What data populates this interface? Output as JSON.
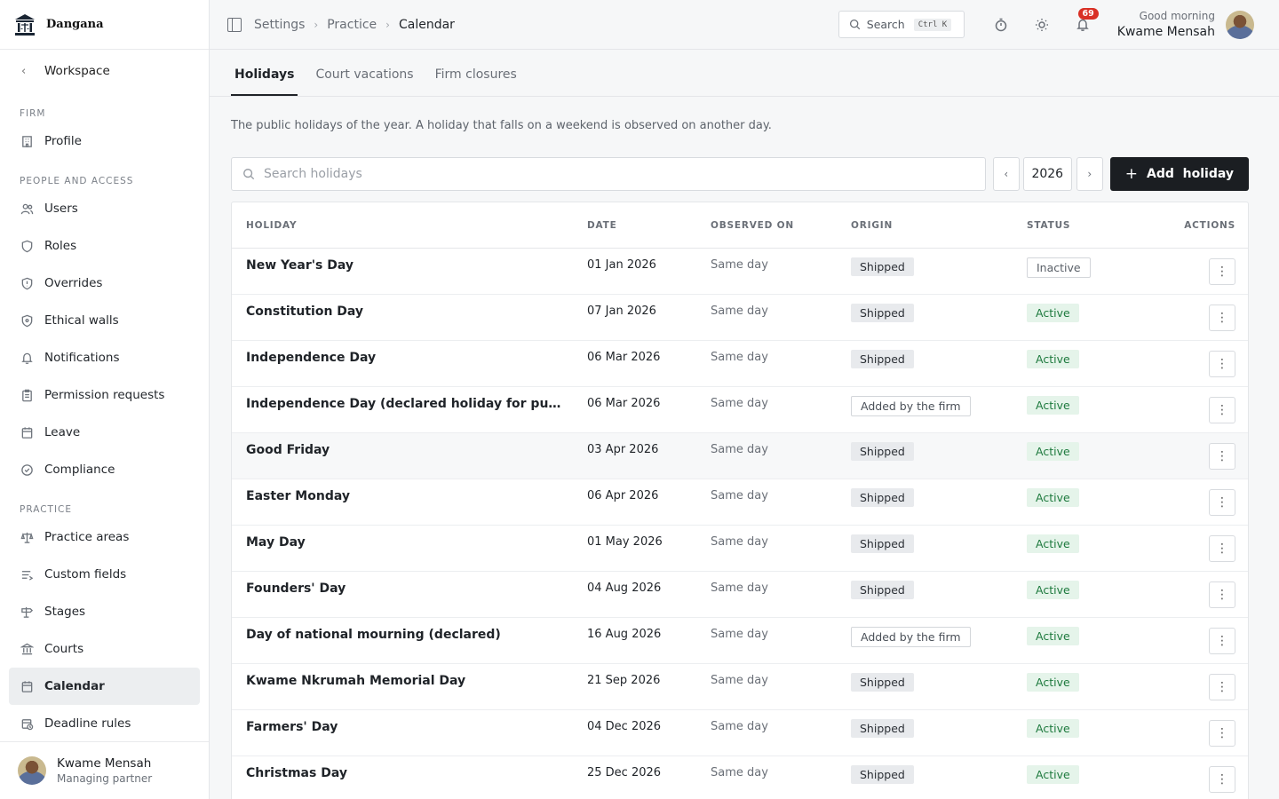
{
  "brand": {
    "name": "Dangana",
    "logo_icon": "courthouse-scales-logo"
  },
  "sidebar": {
    "back_label": "Workspace",
    "sections": [
      {
        "title": "FIRM",
        "items": [
          {
            "label": "Profile",
            "icon": "building-icon"
          }
        ]
      },
      {
        "title": "PEOPLE AND ACCESS",
        "items": [
          {
            "label": "Users",
            "icon": "users-icon"
          },
          {
            "label": "Roles",
            "icon": "shield-icon"
          },
          {
            "label": "Overrides",
            "icon": "shield-alert-icon"
          },
          {
            "label": "Ethical walls",
            "icon": "shield-lock-icon"
          },
          {
            "label": "Notifications",
            "icon": "bell-icon"
          },
          {
            "label": "Permission requests",
            "icon": "clipboard-icon"
          },
          {
            "label": "Leave",
            "icon": "calendar-icon"
          },
          {
            "label": "Compliance",
            "icon": "check-circle-icon"
          }
        ]
      },
      {
        "title": "PRACTICE",
        "items": [
          {
            "label": "Practice areas",
            "icon": "scales-icon"
          },
          {
            "label": "Custom fields",
            "icon": "list-icon"
          },
          {
            "label": "Stages",
            "icon": "signpost-icon"
          },
          {
            "label": "Courts",
            "icon": "courthouse-icon"
          },
          {
            "label": "Calendar",
            "icon": "calendar-icon",
            "active": true
          },
          {
            "label": "Deadline rules",
            "icon": "calendar-clock-icon"
          }
        ]
      }
    ],
    "user": {
      "name": "Kwame Mensah",
      "role": "Managing partner"
    }
  },
  "header": {
    "breadcrumb": [
      "Settings",
      "Practice",
      "Calendar"
    ],
    "search_label": "Search",
    "search_shortcut": "Ctrl K",
    "notification_count": "69",
    "greeting": "Good morning",
    "user_name": "Kwame Mensah"
  },
  "tabs": [
    "Holidays",
    "Court vacations",
    "Firm closures"
  ],
  "description": "The public holidays of the year. A holiday that falls on a weekend is observed on another day.",
  "toolbar": {
    "search_placeholder": "Search holidays",
    "year": "2026",
    "add_label": "Add  holiday"
  },
  "table": {
    "columns": [
      "HOLIDAY",
      "DATE",
      "OBSERVED ON",
      "ORIGIN",
      "STATUS",
      "ACTIONS"
    ],
    "rows": [
      {
        "holiday": "New Year's Day",
        "date": "01 Jan 2026",
        "observed": "Same day",
        "origin": "Shipped",
        "status": "Inactive"
      },
      {
        "holiday": "Constitution Day",
        "date": "07 Jan 2026",
        "observed": "Same day",
        "origin": "Shipped",
        "status": "Active"
      },
      {
        "holiday": "Independence Day",
        "date": "06 Mar 2026",
        "observed": "Same day",
        "origin": "Shipped",
        "status": "Active"
      },
      {
        "holiday": "Independence Day (declared holiday for public servants)",
        "date": "06 Mar 2026",
        "observed": "Same day",
        "origin": "Added by the firm",
        "status": "Active"
      },
      {
        "holiday": "Good Friday",
        "date": "03 Apr 2026",
        "observed": "Same day",
        "origin": "Shipped",
        "status": "Active"
      },
      {
        "holiday": "Easter Monday",
        "date": "06 Apr 2026",
        "observed": "Same day",
        "origin": "Shipped",
        "status": "Active"
      },
      {
        "holiday": "May Day",
        "date": "01 May 2026",
        "observed": "Same day",
        "origin": "Shipped",
        "status": "Active"
      },
      {
        "holiday": "Founders' Day",
        "date": "04 Aug 2026",
        "observed": "Same day",
        "origin": "Shipped",
        "status": "Active"
      },
      {
        "holiday": "Day of national mourning (declared)",
        "date": "16 Aug 2026",
        "observed": "Same day",
        "origin": "Added by the firm",
        "status": "Active"
      },
      {
        "holiday": "Kwame Nkrumah Memorial Day",
        "date": "21 Sep 2026",
        "observed": "Same day",
        "origin": "Shipped",
        "status": "Active"
      },
      {
        "holiday": "Farmers' Day",
        "date": "04 Dec 2026",
        "observed": "Same day",
        "origin": "Shipped",
        "status": "Active"
      },
      {
        "holiday": "Christmas Day",
        "date": "25 Dec 2026",
        "observed": "Same day",
        "origin": "Shipped",
        "status": "Active"
      }
    ]
  },
  "colors": {
    "active_bg": "#e5f4ea",
    "active_text": "#1e7a3e",
    "badge": "#d93025",
    "primary_button": "#1b1e22"
  }
}
